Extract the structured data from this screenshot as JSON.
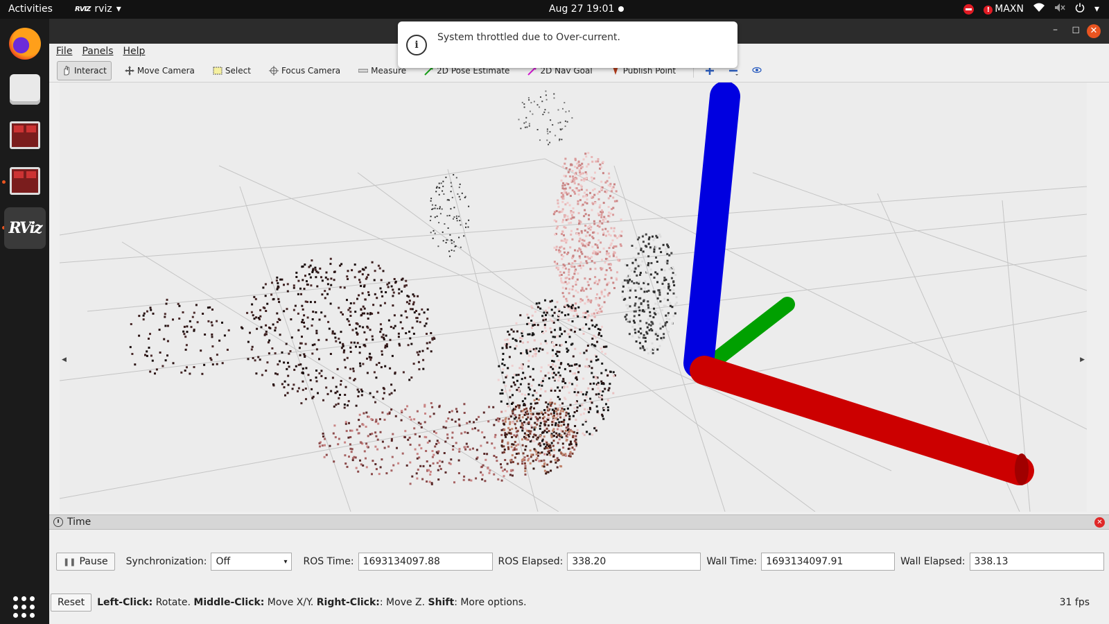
{
  "topbar": {
    "activities": "Activities",
    "app_logo": "RVIZ",
    "app_name": "rviz",
    "datetime": "Aug 27  19:01",
    "power_mode": "MAXN"
  },
  "dock": {
    "items": [
      "firefox-icon",
      "files-icon",
      "terminal-icon",
      "terminal-icon",
      "rviz-icon"
    ],
    "rviz_logo": "RViz"
  },
  "notification": {
    "message": "System throttled due to Over-current."
  },
  "menu": {
    "file": "File",
    "panels": "Panels",
    "help": "Help"
  },
  "toolbar": {
    "interact": "Interact",
    "move_camera": "Move Camera",
    "select": "Select",
    "focus_camera": "Focus Camera",
    "measure": "Measure",
    "pose_estimate": "2D Pose Estimate",
    "nav_goal": "2D Nav Goal",
    "publish_point": "Publish Point"
  },
  "axes": {
    "x_color": "#cc0000",
    "y_color": "#00a000",
    "z_color": "#0000e0"
  },
  "time_panel": {
    "title": "Time",
    "pause": "Pause",
    "sync_label": "Synchronization:",
    "sync_value": "Off",
    "ros_time_label": "ROS Time:",
    "ros_time": "1693134097.88",
    "ros_elapsed_label": "ROS Elapsed:",
    "ros_elapsed": "338.20",
    "wall_time_label": "Wall Time:",
    "wall_time": "1693134097.91",
    "wall_elapsed_label": "Wall Elapsed:",
    "wall_elapsed": "338.13"
  },
  "status": {
    "reset": "Reset",
    "left_click": "Left-Click:",
    "left_click_desc": " Rotate. ",
    "middle_click": "Middle-Click:",
    "middle_click_desc": " Move X/Y. ",
    "right_click": "Right-Click:",
    "right_click_desc": ": Move Z. ",
    "shift": "Shift",
    "shift_desc": ": More options.",
    "fps": "31 fps"
  }
}
